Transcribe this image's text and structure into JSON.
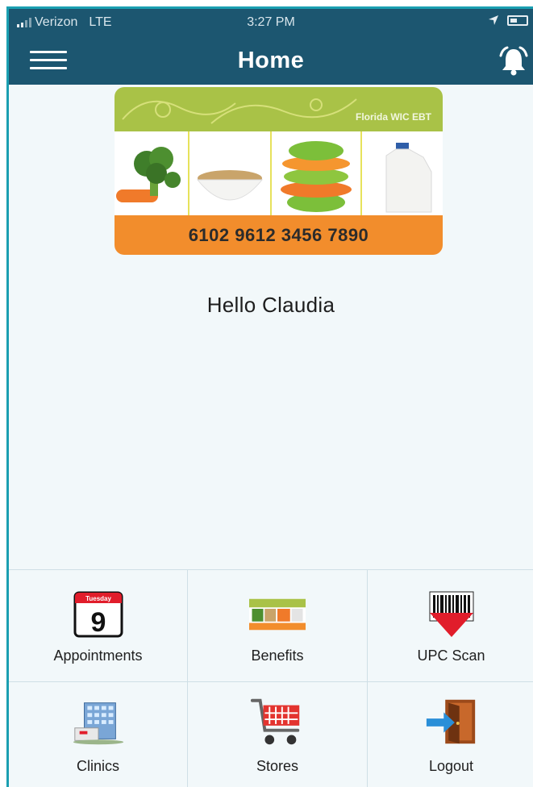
{
  "status_bar": {
    "carrier": "Verizon",
    "network": "LTE",
    "time": "3:27 PM"
  },
  "nav": {
    "title": "Home",
    "menu_icon": "hamburger-menu-icon",
    "alert_icon": "alarm-bell-icon"
  },
  "card": {
    "brand": "Florida WIC EBT",
    "number": "6102 9612 3456 7890"
  },
  "greeting": "Hello Claudia",
  "calendar_icon": {
    "day_name": "Tuesday",
    "day_number": "9"
  },
  "tiles": [
    {
      "label": "Appointments",
      "icon": "calendar-icon"
    },
    {
      "label": "Benefits",
      "icon": "benefits-card-icon"
    },
    {
      "label": "UPC Scan",
      "icon": "barcode-scan-icon"
    },
    {
      "label": "Clinics",
      "icon": "hospital-building-icon"
    },
    {
      "label": "Stores",
      "icon": "shopping-cart-icon"
    },
    {
      "label": "Logout",
      "icon": "logout-door-icon"
    }
  ],
  "colors": {
    "header": "#1c5670",
    "accent": "#1b9fb1",
    "background": "#f2f8fa",
    "card_orange": "#f28d2c",
    "card_green": "#a9c247"
  }
}
